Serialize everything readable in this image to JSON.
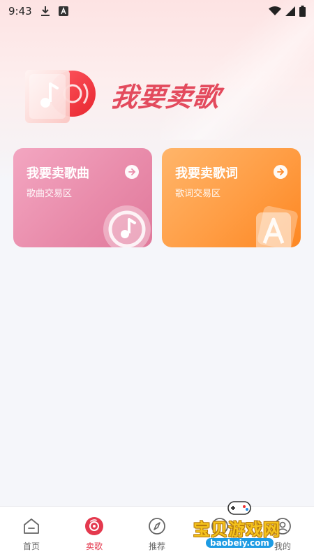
{
  "status_bar": {
    "time": "9:43",
    "icons": [
      "download-icon",
      "font-icon",
      "wifi-icon",
      "signal-icon",
      "battery-icon"
    ]
  },
  "hero": {
    "title": "我要卖歌"
  },
  "cards": [
    {
      "title": "我要卖歌曲",
      "subtitle": "歌曲交易区",
      "deco_icon": "music-note-icon",
      "color": "#e98cab"
    },
    {
      "title": "我要卖歌词",
      "subtitle": "歌词交易区",
      "deco_icon": "letter-a-icon",
      "color": "#fd8a2a"
    }
  ],
  "nav": {
    "items": [
      {
        "label": "首页",
        "icon": "home-icon",
        "active": false
      },
      {
        "label": "卖歌",
        "icon": "disc-icon",
        "active": true
      },
      {
        "label": "推荐",
        "icon": "compass-icon",
        "active": false
      },
      {
        "label": "",
        "icon": "watermark-covered-icon",
        "active": false
      },
      {
        "label": "我的",
        "icon": "user-icon",
        "active": false
      }
    ],
    "active_color": "#e4394e"
  },
  "watermark": {
    "text": "宝贝游戏网",
    "url": "baobeiy.com"
  }
}
